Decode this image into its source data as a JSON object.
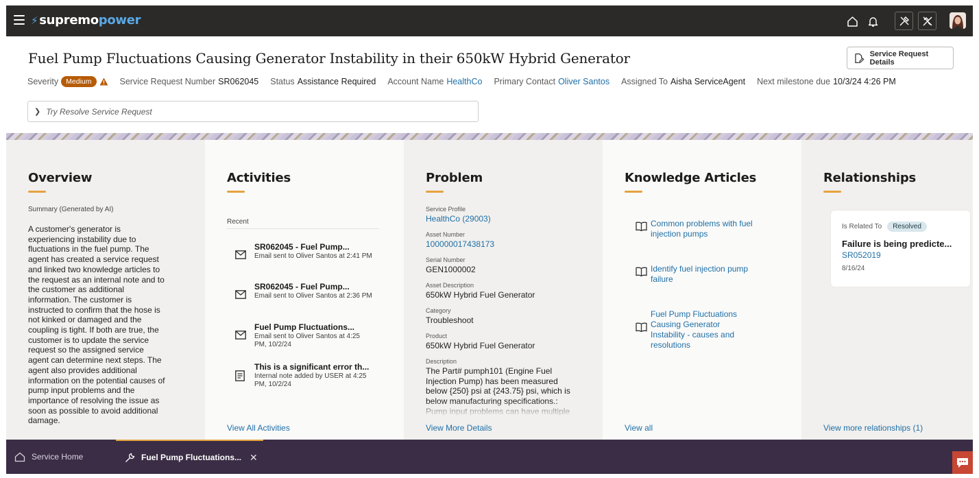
{
  "app": {
    "logo_prefix": "supremo",
    "logo_suffix": "power"
  },
  "header": {
    "title": "Fuel Pump Fluctuations Causing Generator Instability in their 650kW Hybrid Generator",
    "details_button": "Service Request Details",
    "severity_label": "Severity",
    "severity_value": "Medium",
    "sr_number_label": "Service Request Number",
    "sr_number_value": "SR062045",
    "status_label": "Status",
    "status_value": "Assistance Required",
    "account_label": "Account Name",
    "account_value": "HealthCo",
    "contact_label": "Primary Contact",
    "contact_value": "Oliver Santos",
    "assigned_label": "Assigned To",
    "assigned_value": "Aisha ServiceAgent",
    "milestone_label": "Next milestone due",
    "milestone_value": "10/3/24 4:26 PM",
    "try_resolve": "Try Resolve Service Request"
  },
  "overview": {
    "title": "Overview",
    "summary_label": "Summary (Generated by AI)",
    "summary": "A customer's generator is experiencing instability due to fluctuations in the fuel pump. The agent has created a service request and linked two knowledge articles to the request as an internal note and to the customer as additional information. The customer is instructed to confirm that the hose is not kinked or damaged and the coupling is tight. If both are true, the customer is to update the service request so the assigned service agent can determine next steps. The agent also provides additional information on the potential causes of pump input problems and the importance of resolving the issue as soon as possible to avoid additional damage."
  },
  "activities": {
    "title": "Activities",
    "recent_label": "Recent",
    "items": [
      {
        "icon": "mail-icon",
        "title": "SR062045 - Fuel Pump...",
        "detail": "Email sent to Oliver Santos at 2:41 PM"
      },
      {
        "icon": "mail-icon",
        "title": "SR062045 - Fuel Pump...",
        "detail": "Email sent to Oliver Santos at 2:36 PM"
      },
      {
        "icon": "mail-icon",
        "title": "Fuel Pump Fluctuations...",
        "detail": "Email sent to Oliver Santos at 4:25 PM, 10/2/24"
      },
      {
        "icon": "note-icon",
        "title": "This is a significant error th...",
        "detail": "Internal note added by USER at 4:25 PM, 10/2/24"
      }
    ],
    "footer": "View All Activities"
  },
  "problem": {
    "title": "Problem",
    "fields": [
      {
        "label": "Service Profile",
        "value": "HealthCo (29003)"
      },
      {
        "label": "Asset Number",
        "value": "100000017438173"
      },
      {
        "label": "Serial Number",
        "value": "GEN1000002"
      },
      {
        "label": "Asset Description",
        "value": "650kW Hybrid Fuel Generator"
      },
      {
        "label": "Category",
        "value": "Troubleshoot"
      },
      {
        "label": "Product",
        "value": "650kW Hybrid Fuel Generator"
      },
      {
        "label": "Description",
        "value": "The Part# pumph101 (Engine Fuel Injection Pump) has been measured below {250} psi at {243.75} psi, which is below manufacturing specifications.: Pump input problems can have multiple"
      }
    ],
    "footer": "View More Details"
  },
  "knowledge": {
    "title": "Knowledge Articles",
    "items": [
      {
        "icon": "book-icon",
        "title": "Common problems with fuel injection pumps"
      },
      {
        "icon": "book-icon",
        "title": "Identify fuel injection pump failure"
      },
      {
        "icon": "book-icon",
        "title": "Fuel Pump Fluctuations Causing Generator Instability - causes and resolutions"
      }
    ],
    "footer": "View all"
  },
  "relationships": {
    "title": "Relationships",
    "card": {
      "relation": "Is Related To",
      "status": "Resolved",
      "title": "Failure is being predicte...",
      "number": "SR052019",
      "date": "8/16/24"
    },
    "footer": "View more relationships (1)"
  },
  "bottom_tabs": {
    "home": "Service Home",
    "active": "Fuel Pump Fluctuations..."
  },
  "colors": {
    "topbar": "#2b2a28",
    "accent": "#e6a23d",
    "link": "#1f6fa6",
    "severity": "#b65b06",
    "bottombar": "#3a2d45",
    "chat": "#c74634"
  }
}
